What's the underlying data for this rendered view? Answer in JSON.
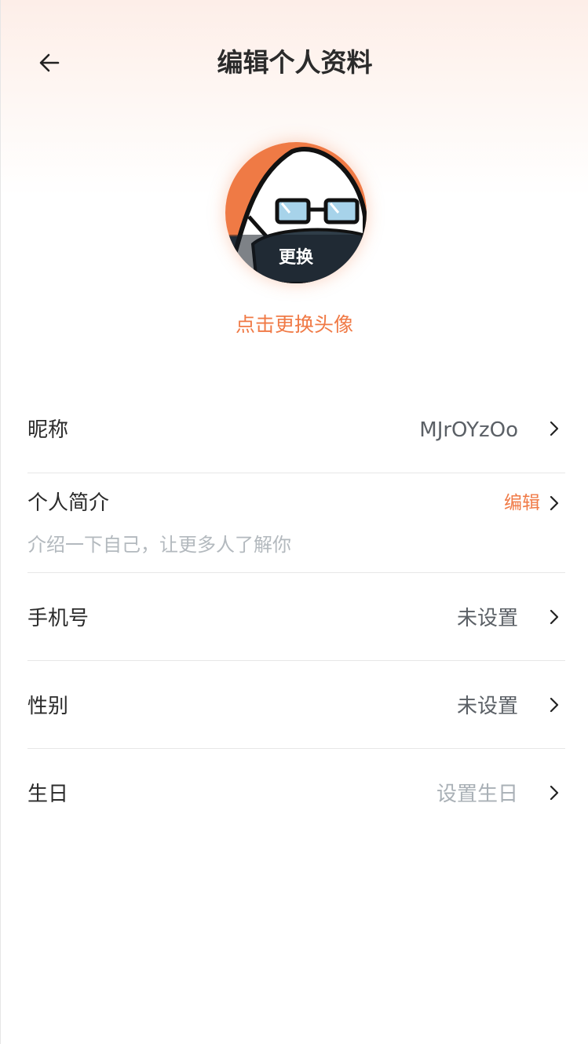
{
  "header": {
    "title": "编辑个人资料"
  },
  "avatar": {
    "overlay_label": "更换",
    "hint": "点击更换头像"
  },
  "profile": {
    "nickname": {
      "label": "昵称",
      "value": "MJrOYzOo"
    },
    "bio": {
      "label": "个人简介",
      "action": "编辑",
      "placeholder": "介绍一下自己，让更多人了解你"
    },
    "phone": {
      "label": "手机号",
      "value": "未设置"
    },
    "gender": {
      "label": "性别",
      "value": "未设置"
    },
    "birthday": {
      "label": "生日",
      "value": "设置生日"
    }
  },
  "icons": {
    "back": "arrow-left-icon",
    "chevron": "chevron-right-icon"
  },
  "colors": {
    "accent": "#f07a46",
    "text_primary": "#2b2b2b",
    "text_secondary": "#5b6066",
    "text_placeholder": "#a9b0b6"
  }
}
